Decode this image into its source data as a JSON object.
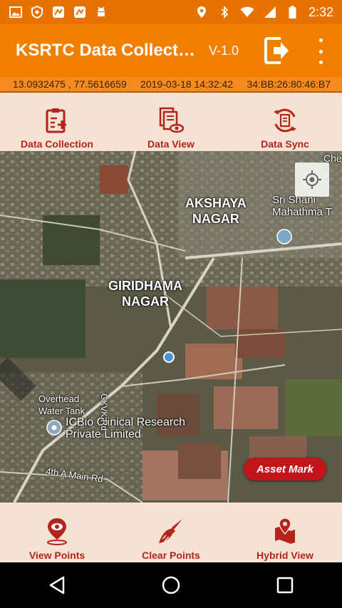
{
  "status_bar": {
    "time": "2:32",
    "left_icons": [
      "image-icon",
      "shield-icon",
      "app-icon-1",
      "app-icon-2",
      "android-icon"
    ],
    "right_icons": [
      "location-icon",
      "bluetooth-icon",
      "wifi-icon",
      "signal-icon",
      "battery-icon"
    ]
  },
  "app_bar": {
    "title": "KSRTC Data Collection",
    "version": "V-1.0"
  },
  "info_bar": {
    "coordinates": "13.0932475 , 77.5616659",
    "datetime": "2019-03-18 14:32:42",
    "mac": "34:BB:26:80:46:B7"
  },
  "top_nav": [
    {
      "label": "Data Collection",
      "icon": "clipboard-add-icon"
    },
    {
      "label": "Data View",
      "icon": "document-view-icon"
    },
    {
      "label": "Data Sync",
      "icon": "sync-document-icon"
    }
  ],
  "map": {
    "labels": {
      "akshaya": "AKSHAYA\nNAGAR",
      "giridhama": "GIRIDHAMA\nNAGAR",
      "sri_shani": "Sri Shani\nMahathma T",
      "overhead": "Overhead\nWater Tank",
      "icbio": "ICBio Clinical Research\nPrivate Limited",
      "main_rd": "4th A Main Rd",
      "gkvk_rd": "GKVK Rd",
      "che": "Che"
    },
    "asset_mark_label": "Asset Mark"
  },
  "bottom_nav": [
    {
      "label": "View Points",
      "icon": "eye-pin-icon"
    },
    {
      "label": "Clear Points",
      "icon": "brush-icon"
    },
    {
      "label": "Hybrid View",
      "icon": "map-pin-icon"
    }
  ],
  "colors": {
    "status_bar": "#e87100",
    "app_bar": "#f27f00",
    "info_bar": "#f58a1f",
    "nav_background": "#f6e2d2",
    "nav_label": "#b4241c",
    "asset_button": "#c3161b"
  }
}
